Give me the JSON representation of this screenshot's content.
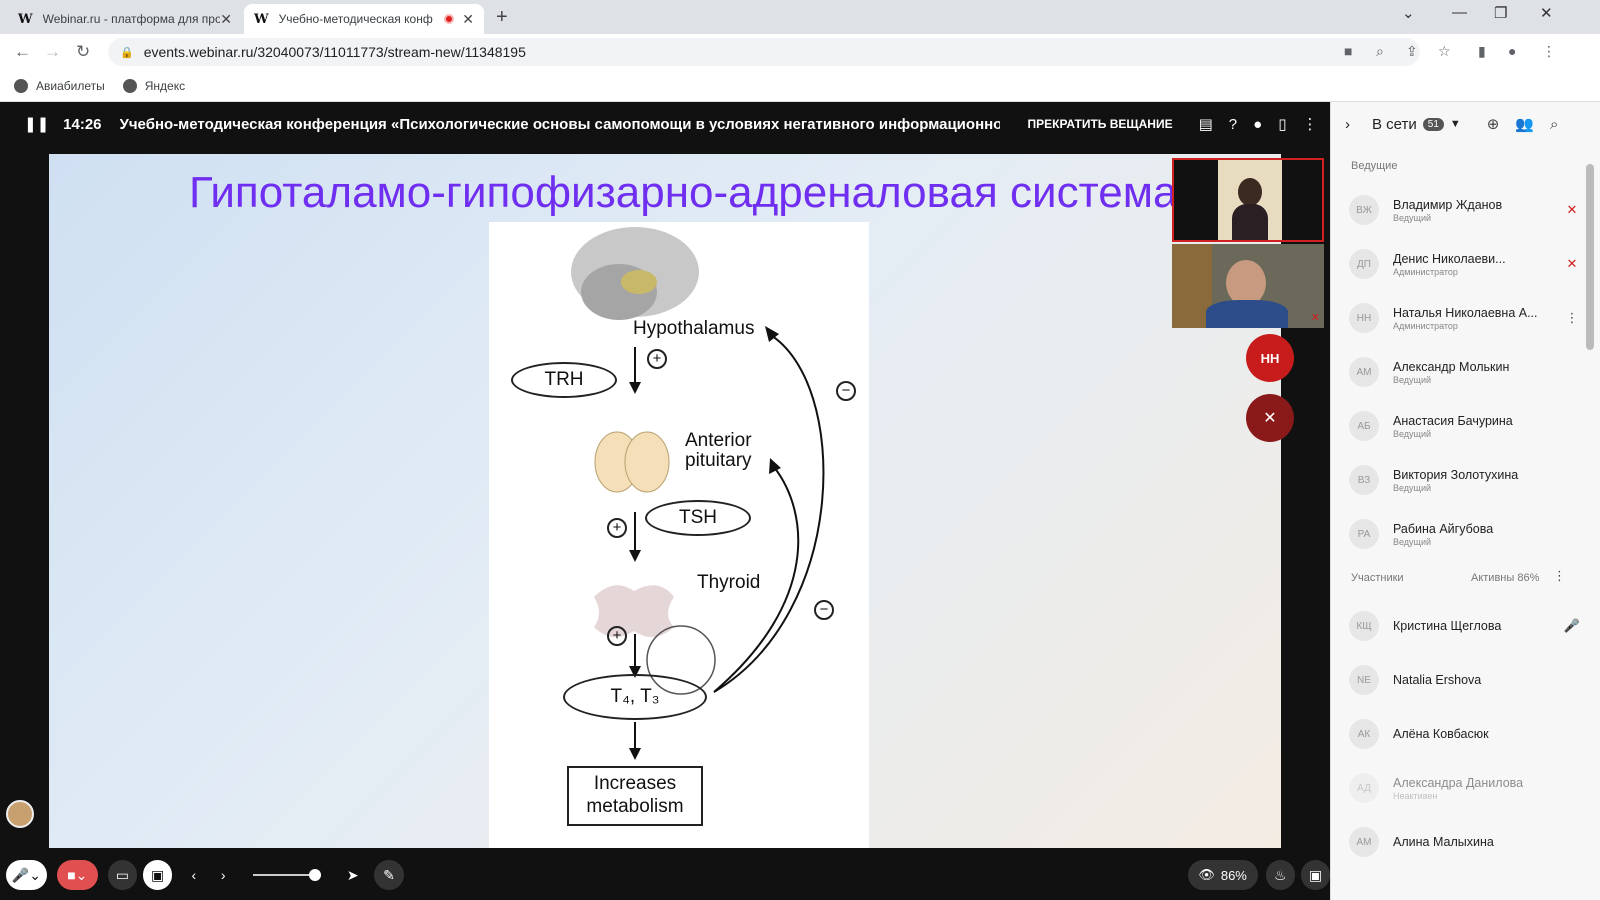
{
  "browser": {
    "tabs": [
      {
        "favicon": "W",
        "title": "Webinar.ru - платформа для про"
      },
      {
        "favicon": "W",
        "title": "Учебно-методическая конф"
      }
    ],
    "url": "events.webinar.ru/32040073/11011773/stream-new/11348195",
    "bookmarks": [
      "Авиабилеты",
      "Яндекс"
    ]
  },
  "stream": {
    "time": "14:26",
    "title": "Учебно-методическая конференция «Психологические основы самопомощи в условиях негативного информационного в",
    "stop_label": "ПРЕКРАТИТЬ ВЕЩАНИЕ"
  },
  "slide": {
    "title": "Гипоталамо-гипофизарно-адреналовая система",
    "diagram": {
      "hypothalamus": "Hypothalamus",
      "trh": "TRH",
      "anterior": "Anterior",
      "pituitary": "pituitary",
      "tsh": "TSH",
      "thyroid": "Thyroid",
      "t4t3": "T₄, T₃",
      "increases": "Increases",
      "metabolism": "metabolism",
      "plus": "+",
      "minus": "−"
    }
  },
  "videos": {
    "bubble_initials": "НН"
  },
  "bottom": {
    "zoom": "86%"
  },
  "sidebar": {
    "online_label": "В сети",
    "online_count": "51",
    "hosts_label": "Ведущие",
    "participants_label": "Участники",
    "active_label": "Активны 86%",
    "hosts": [
      {
        "initials": "ВЖ",
        "name": "Владимир Жданов",
        "role": "Ведущий"
      },
      {
        "initials": "ДП",
        "name": "Денис Николаеви...",
        "role": "Администратор"
      },
      {
        "initials": "НН",
        "name": "Наталья Николаевна А...",
        "role": "Администратор"
      },
      {
        "initials": "АМ",
        "name": "Александр Молькин",
        "role": "Ведущий"
      },
      {
        "initials": "АБ",
        "name": "Анастасия Бачурина",
        "role": "Ведущий"
      },
      {
        "initials": "ВЗ",
        "name": "Виктория Золотухина",
        "role": "Ведущий"
      },
      {
        "initials": "РА",
        "name": "Рабина Айгубова",
        "role": "Ведущий"
      }
    ],
    "participants": [
      {
        "initials": "КЩ",
        "name": "Кристина Щеглова",
        "role": ""
      },
      {
        "initials": "NE",
        "name": "Natalia Ershova",
        "role": ""
      },
      {
        "initials": "АК",
        "name": "Алёна Ковбасюк",
        "role": ""
      },
      {
        "initials": "АД",
        "name": "Александра Данилова",
        "role": "Неактивен"
      },
      {
        "initials": "АМ",
        "name": "Алина Малыхина",
        "role": ""
      }
    ]
  },
  "colors": {
    "accent_red": "#d02020",
    "slide_title": "#6f2ef0"
  }
}
